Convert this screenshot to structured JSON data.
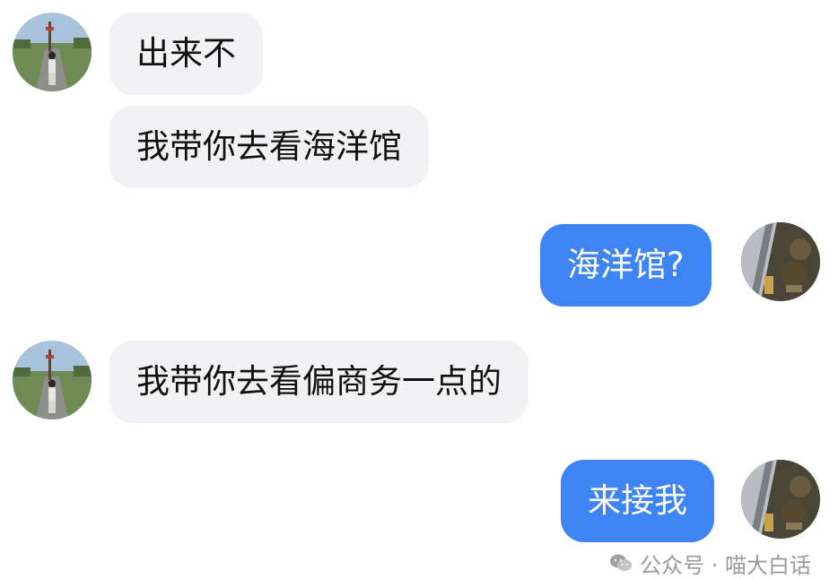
{
  "messages": [
    {
      "side": "left",
      "text": "出来不"
    },
    {
      "side": "left",
      "text": "我带你去看海洋馆"
    },
    {
      "side": "right",
      "text": "海洋馆?"
    },
    {
      "side": "left",
      "text": "我带你去看偏商务一点的"
    },
    {
      "side": "right",
      "text": "来接我"
    }
  ],
  "watermark": {
    "icon": "wechat-icon",
    "text": "公众号 · 喵大白话"
  },
  "colors": {
    "incoming_bubble": "#f2f2f4",
    "outgoing_bubble": "#3e84f4",
    "incoming_text": "#111111",
    "outgoing_text": "#ffffff"
  }
}
